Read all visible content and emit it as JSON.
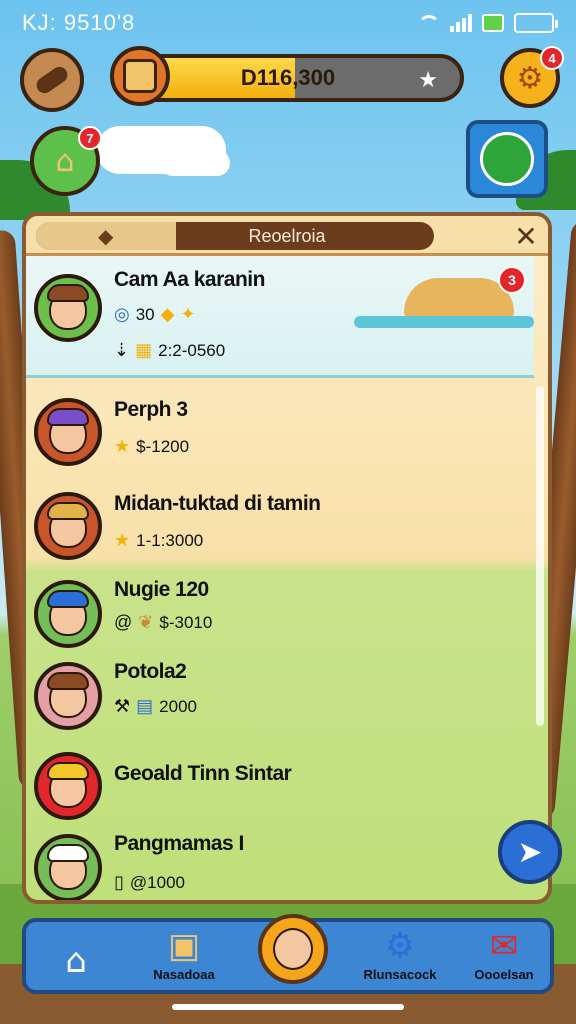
{
  "status": {
    "time": "KJ: 9510'8"
  },
  "hud": {
    "gear_badge": "4",
    "home_badge": "7",
    "coin_value": "D116,300",
    "coin_progress": 0.52
  },
  "panel": {
    "title": "Reoelroia",
    "close_glyph": "✕"
  },
  "players": [
    {
      "name": "Cam Aa karanin",
      "stat_line_1": "30",
      "stat_line_2": "2:2-0560",
      "badge": "3",
      "avatar_bg": "#6cc04a",
      "hair": "#8b4a23"
    },
    {
      "name": "Perph 3",
      "stat": "$-1200",
      "avatar_bg": "#c9552a",
      "hair": "#7b4ec9"
    },
    {
      "name": "Midan-tuktad di tamin",
      "stat": "1-1:3000",
      "avatar_bg": "#c9552a",
      "hair": "#e2b24a"
    },
    {
      "name": "Nugie 120",
      "stat": "$-3010",
      "avatar_bg": "#74bd57",
      "hair": "#2b6ed6"
    },
    {
      "name": "Potola2",
      "stat": "2000",
      "avatar_bg": "#e4a0a6",
      "hair": "#8b4a23"
    },
    {
      "name": "Geoald Tinn Sintar",
      "stat": "",
      "avatar_bg": "#e3262b",
      "hair": "#f3c62a"
    },
    {
      "name": "Pangmamas I",
      "stat": "@1000",
      "avatar_bg": "#74bd57",
      "hair": "#ffffff"
    }
  ],
  "nav": {
    "items": [
      {
        "label": "",
        "icon": "home-icon"
      },
      {
        "label": "Nasadoaa",
        "icon": "inventory-icon"
      },
      {
        "label": "",
        "icon": "profile-icon"
      },
      {
        "label": "Rlunsacock",
        "icon": "settings-icon"
      },
      {
        "label": "Oooelsan",
        "icon": "mail-icon"
      }
    ]
  },
  "colors": {
    "panel_border": "#8a5a31",
    "nav_blue": "#3d86d3",
    "accent_gold": "#f3b10e",
    "badge_red": "#e3262b"
  }
}
